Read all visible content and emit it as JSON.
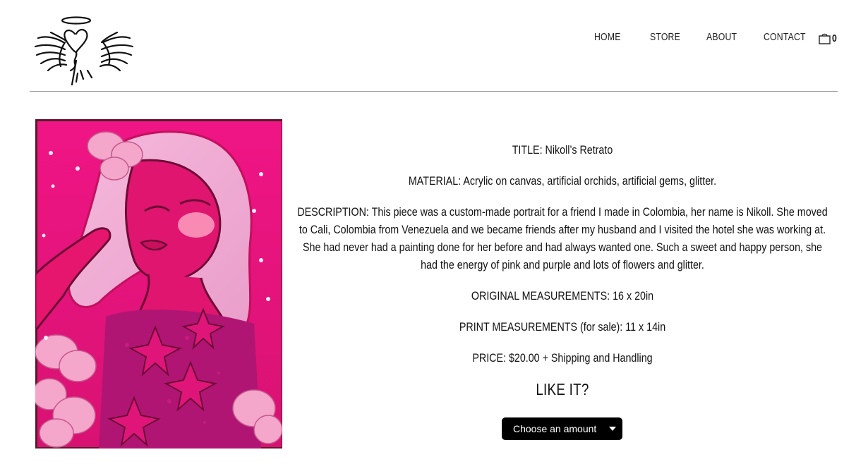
{
  "header": {
    "logo": "angel-logo",
    "nav": [
      {
        "label": "HOME"
      },
      {
        "label": "STORE"
      },
      {
        "label": "ABOUT"
      },
      {
        "label": "CONTACT"
      }
    ],
    "cart_icon": "shopping-bag-icon",
    "cart_count": "0"
  },
  "product": {
    "image": "artwork-nikolls-retrato",
    "title": "TITLE: Nikoll’s Retrato",
    "material": "MATERIAL: Acrylic on canvas, artificial orchids, artificial gems, glitter.",
    "description": "DESCRIPTION: This piece was a custom-made portrait for a friend I made in Colombia, her name is Nikoll. She moved to Cali, Colombia from Venezuela and we became friends after my husband and I visited the hotel she was working at. She had never had a painting done for her before and had always wanted one. Such a sweet and happy person, she had the energy of pink and purple and lots of flowers and glitter.",
    "original_measurements": "ORIGINAL MEASUREMENTS: 16 x 20in",
    "print_measurements": "PRINT MEASUREMENTS (for sale): 11 x 14in",
    "price": "PRICE: $20.00 + Shipping and Handling",
    "cta_heading": "LIKE IT?",
    "amount_button": "Choose an amount",
    "amount_icon": "caret-down-icon"
  },
  "colors": {
    "accent_pink": "#e8197a",
    "button_bg": "#000000"
  }
}
